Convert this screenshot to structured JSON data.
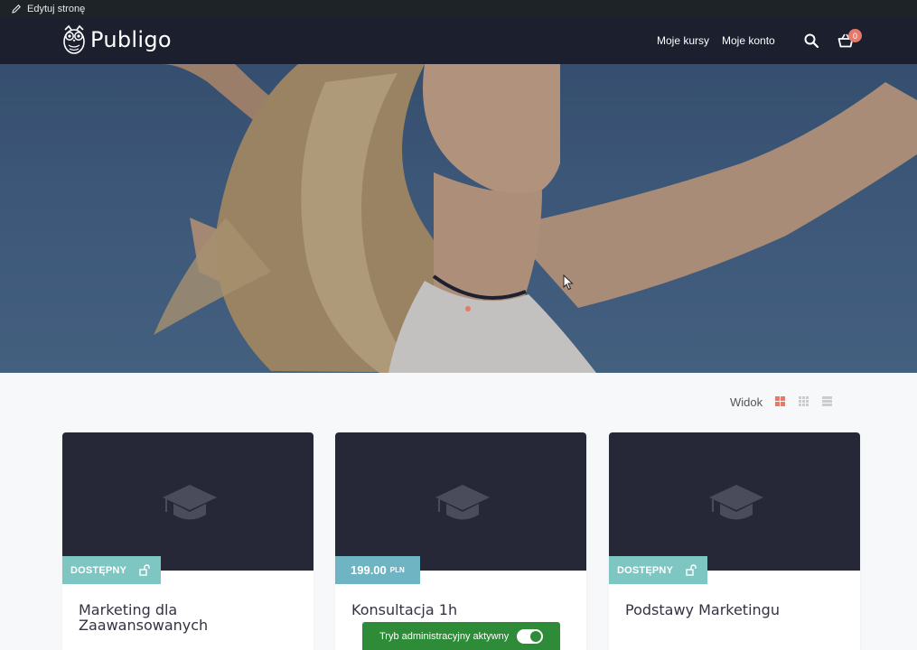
{
  "admin_bar": {
    "edit_label": "Edytuj stronę"
  },
  "header": {
    "logo_text": "Publigo",
    "nav": [
      "Moje kursy",
      "Moje konto"
    ],
    "cart_count": "0"
  },
  "hero": {
    "slides_count": 1
  },
  "view_switcher": {
    "label": "Widok",
    "options": [
      "grid-large",
      "grid-small",
      "list"
    ],
    "active": "grid-large",
    "active_color": "#e8786a",
    "inactive_color": "#cccccc"
  },
  "courses": [
    {
      "title": "Marketing dla Zaawansowanych",
      "badge_type": "status",
      "badge_text": "DOSTĘPNY"
    },
    {
      "title": "Konsultacja 1h",
      "badge_type": "price",
      "price": "199.00",
      "currency": "PLN"
    },
    {
      "title": "Podstawy Marketingu",
      "badge_type": "status",
      "badge_text": "DOSTĘPNY"
    }
  ],
  "admin_toast": {
    "label": "Tryb administracyjny aktywny",
    "toggle_on": true
  },
  "colors": {
    "header_bg": "#1b1f2e",
    "accent": "#e8786a",
    "status_badge": "#7ec6c1",
    "price_badge": "#6eb4c3",
    "toast_bg": "#2e8b37"
  }
}
